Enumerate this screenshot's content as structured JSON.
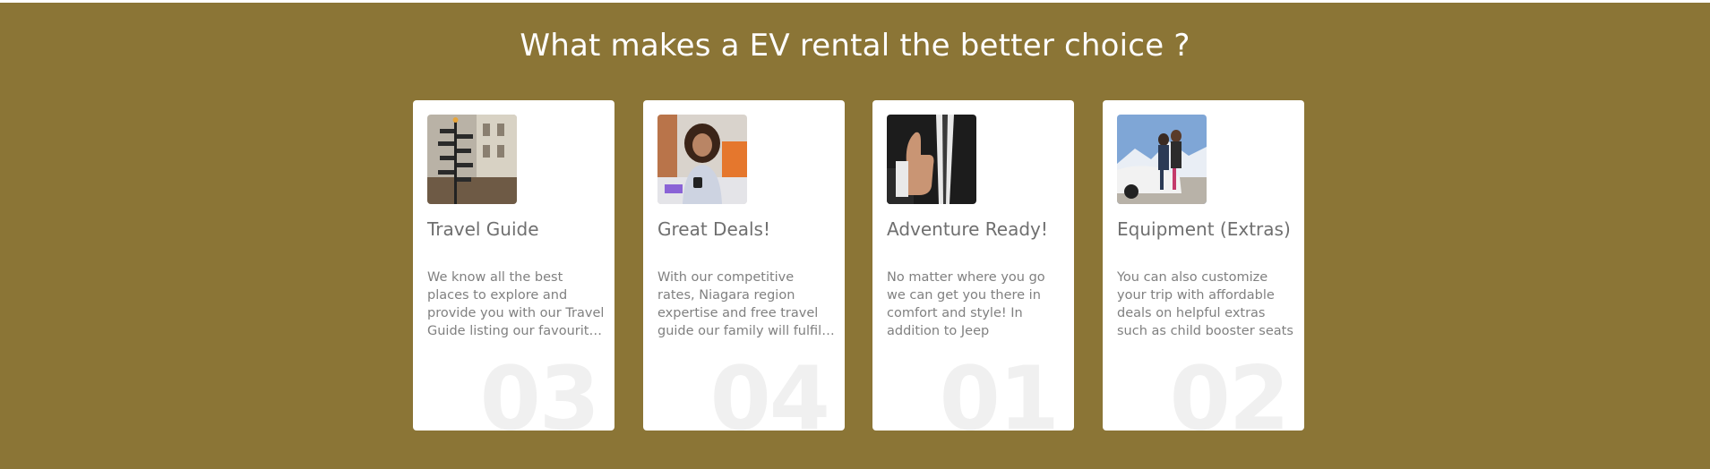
{
  "section": {
    "title": "What makes a EV rental the better choice ?",
    "background": "#8b7536"
  },
  "cards": [
    {
      "image_icon": "signpost-photo",
      "title": "Travel Guide",
      "text": "We know all the best places to explore and provide you with our Travel Guide listing our favourite spots",
      "number": "03"
    },
    {
      "image_icon": "woman-with-phone-photo",
      "title": "Great Deals!",
      "text": "With our competitive rates, Niagara region expertise and free travel guide our family will fulfil all your needs",
      "number": "04"
    },
    {
      "image_icon": "thumbs-up-photo",
      "title": "Adventure Ready!",
      "text": "No matter where you go we can get you there in comfort and style! In addition to Jeep",
      "number": "01"
    },
    {
      "image_icon": "couple-with-car-photo",
      "title": "Equipment (Extras)",
      "text": "You can also customize your trip with affordable deals on helpful extras such as child booster seats",
      "number": "02"
    }
  ]
}
